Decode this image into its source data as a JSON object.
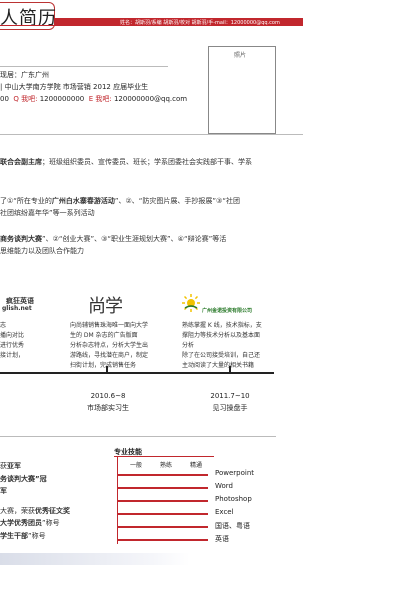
{
  "header": {
    "title": "人简历",
    "bar_text": "姓名：胡斯羽/系编  胡斯羽/校对  胡斯羽/手-mail：12000000@qq.com"
  },
  "photo_label": "照片",
  "info": {
    "line1": "现居：广东广州",
    "line2": "| 中山大学南方学院  市场营销  2012 应届毕业生",
    "line3_pre": "00",
    "qq_label": "Q 我吧:",
    "qq_value": "1200000000",
    "email_label": "E 我吧:",
    "email_value": "120000000@qq.com"
  },
  "para1": {
    "bold": "联合会副主席",
    "rest": "；班级组织委员、宣传委员、班长；学系团委社会实践部干事、学系"
  },
  "para2": {
    "line1_pre": "了①“所在专业的",
    "line1_bold": "广州白水寨春游活动",
    "line1_rest": "”、②、“防灾图片展、手抄报展”③“社团",
    "line2": "社团缤纷嘉年华”等一系列活动"
  },
  "para3": {
    "line1_bold": "商务谈判大赛",
    "line1_rest": "”、②“创业大赛”、③“职业生涯规划大赛”、④“辩论赛”等活",
    "line2": "思维能力以及团队合作能力"
  },
  "companies": [
    {
      "logo_line1": "疯狂英语",
      "logo_line2": "glish.net",
      "desc": [
        "志",
        "播向对比",
        "进行优秀",
        "接计划，"
      ]
    },
    {
      "logo": "尚学",
      "desc": [
        "向尚辅销售珠海唯一面向大学",
        "生的 DM 杂志的广告版面",
        "分析杂志特点，分析大学生出",
        "游路线，寻找潜在商户，制定",
        "扫街计划，完成销售任务"
      ]
    },
    {
      "logo": "广州金诺投资有限公司",
      "desc": [
        "熟练掌握 K 线，技术指标，支",
        "撑阻力等技术分析以及基本面",
        "分析",
        "除了在公司接受培训，自己还",
        "主动阅读了大量的相关书籍"
      ]
    }
  ],
  "timeline": [
    {
      "date": "2010.6~8",
      "label": "市场部实习生"
    },
    {
      "date": "2011.7~10",
      "label": "见习操盘手"
    }
  ],
  "awards": [
    {
      "pre": "获",
      "bold": "亚军",
      "post": ""
    },
    {
      "pre": "",
      "bold": "务谈判大赛”冠",
      "post": ""
    },
    {
      "pre": "",
      "bold": "军",
      "post": ""
    },
    {
      "pre": "大赛，荣获",
      "bold": "优秀征文奖",
      "post": ""
    },
    {
      "pre": "",
      "bold": "大学优秀团员",
      "post": "”称号"
    },
    {
      "pre": "",
      "bold": "学生干部",
      "post": "”称号"
    }
  ],
  "skills": {
    "title": "专业技能",
    "levels": [
      "一般",
      "熟练",
      "精通"
    ],
    "items": [
      {
        "name": "Powerpoint",
        "level": 0.95
      },
      {
        "name": "Word",
        "level": 0.95
      },
      {
        "name": "Photoshop",
        "level": 0.95
      },
      {
        "name": "Excel",
        "level": 0.95
      },
      {
        "name": "国语、粤语",
        "level": 0.95
      },
      {
        "name": "英语",
        "level": 0.95
      }
    ]
  }
}
